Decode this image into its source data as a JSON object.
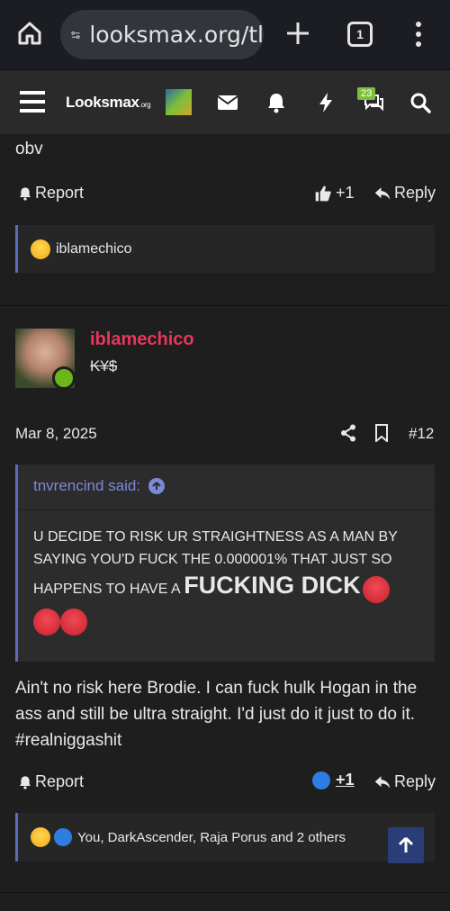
{
  "browser": {
    "url": "looksmax.org/tl",
    "tab_count": "1"
  },
  "site": {
    "logo_main": "Looksmax",
    "logo_suffix": ".org",
    "notification_badge": "23"
  },
  "post_prev": {
    "text": "obv",
    "report_label": "Report",
    "like_count": "+1",
    "reply_label": "Reply",
    "reactions_text": "iblamechico"
  },
  "post": {
    "username": "iblamechico",
    "user_title": "K¥$",
    "date": "Mar 8, 2025",
    "post_number": "#12",
    "quote_author": "tnvrencind said:",
    "quote_text_1": "U DECIDE TO RISK UR STRAIGHTNESS AS A MAN BY SAYING YOU'D FUCK THE 0.000001% THAT JUST SO HAPPENS TO HAVE A ",
    "quote_text_big": "FUCKING DICK",
    "body": "Ain't no risk here Brodie. I can fuck hulk Hogan in the ass and still be ultra straight. I'd just do it just to do it. #realniggashit",
    "report_label": "Report",
    "like_count": "+1",
    "reply_label": "Reply",
    "reactions_text": "You, DarkAscender, Raja Porus and 2 others"
  },
  "colors": {
    "username": "#e8365d",
    "accent": "#5a6bbf",
    "online": "#6db61a"
  }
}
